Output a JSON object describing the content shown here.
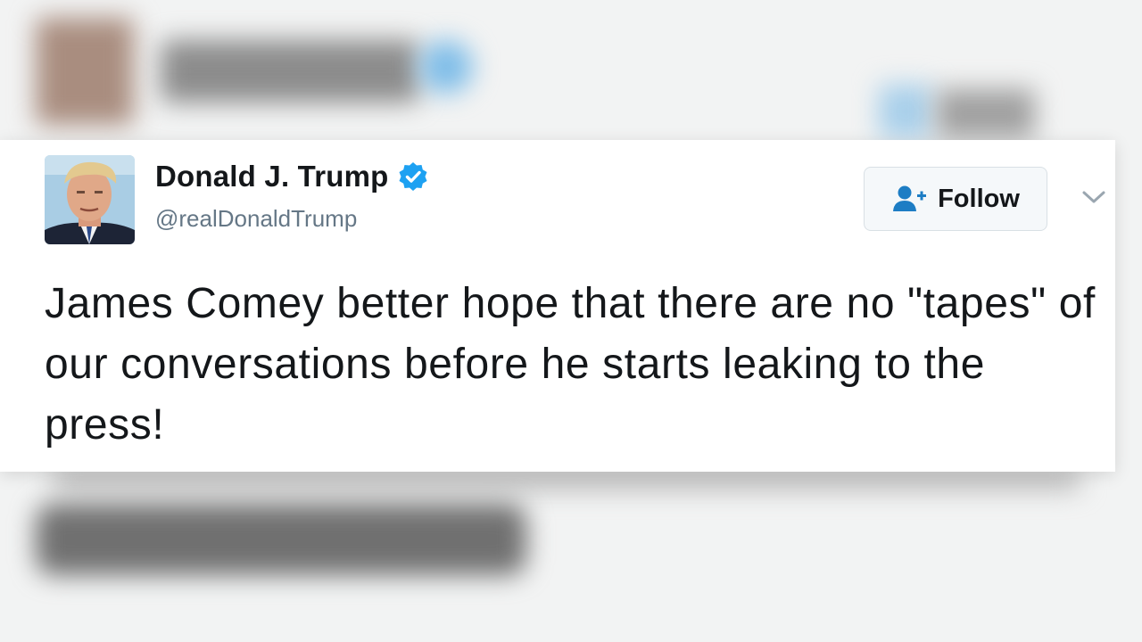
{
  "tweet": {
    "display_name": "Donald J. Trump",
    "handle": "@realDonaldTrump",
    "verified_icon": "verified-badge-icon",
    "follow_label": "Follow",
    "follow_icon": "add-user-icon",
    "menu_icon": "chevron-down-icon",
    "text": "James Comey better hope that there are no \"tapes\" of our conversations before he starts leaking to the press!"
  },
  "colors": {
    "verified_blue": "#1da1f2",
    "handle_gray": "#657786",
    "text_dark": "#14171a",
    "follow_bg": "#f5f8fa"
  }
}
